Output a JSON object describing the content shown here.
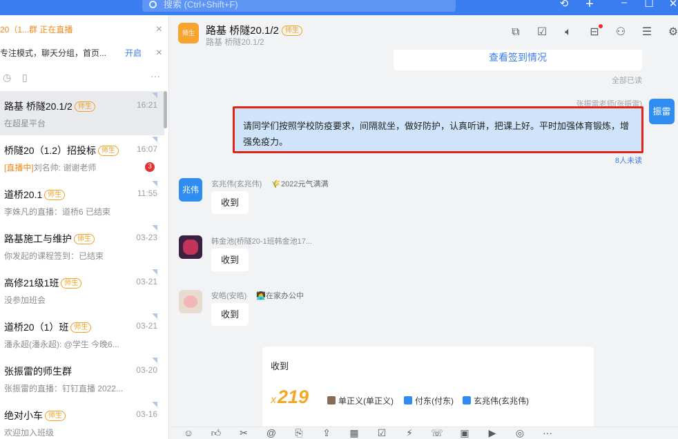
{
  "topbar": {
    "search_placeholder": "搜索 (Ctrl+Shift+F)",
    "icons": [
      "history-icon",
      "plus-icon",
      "minimize-icon",
      "maximize-icon",
      "close-icon"
    ]
  },
  "notices": [
    {
      "text": "20（1...群 正在直播"
    },
    {
      "text": "专注模式，聊天分组，首页...",
      "action": "开启"
    }
  ],
  "conversations": [
    {
      "name": "路基 桥隧20.1/2",
      "tag": "师生",
      "time": "16:21",
      "sub": "在超星平台",
      "live": "",
      "badge": ""
    },
    {
      "name": "桥隧20（1.2）招投标",
      "tag": "师生",
      "time": "16:07",
      "sub": "刘名帅: 谢谢老师",
      "live": "[直播中]",
      "badge": "3"
    },
    {
      "name": "道桥20.1",
      "tag": "师生",
      "time": "11:55",
      "sub": "李姝凡的直播：道桥6 已结束",
      "live": "",
      "badge": ""
    },
    {
      "name": "路基施工与维护",
      "tag": "师生",
      "time": "03-23",
      "sub": "你发起的课程签到：已结束",
      "live": "",
      "badge": ""
    },
    {
      "name": "高修21级1班",
      "tag": "师生",
      "time": "03-21",
      "sub": "没参加班会",
      "live": "",
      "badge": ""
    },
    {
      "name": "道桥20（1）班",
      "tag": "师生",
      "time": "03-21",
      "sub": "潘永超(潘永超): @学生 今晚6...",
      "live": "",
      "badge": ""
    },
    {
      "name": "张振雷的师生群",
      "tag": "",
      "time": "03-20",
      "sub": "张振雷的直播：钉钉直播 2022...",
      "live": "",
      "badge": ""
    },
    {
      "name": "绝对小车",
      "tag": "师生",
      "time": "03-16",
      "sub": "欢迎加入班级",
      "live": "",
      "badge": ""
    }
  ],
  "chat": {
    "logo_text": "师生",
    "title": "路基 桥隧20.1/2",
    "tag": "师生",
    "subtitle": "路基 桥隧20.1/2",
    "signin_link": "查看签到情况",
    "read_all": "全部已读",
    "my_sender": "张振雷老师(张振雷)",
    "my_avatar": "振雷",
    "my_message": "请同学们按照学校防疫要求，间隔就坐，做好防护，认真听讲，把课上好。平时加强体育锻炼，增强免疫力。",
    "unread": "8人未读",
    "messages": [
      {
        "avatar": "兆伟",
        "name": "玄兆伟(玄兆伟)",
        "status": "🌾2022元气满满",
        "text": "收到"
      },
      {
        "avatar": "",
        "name": "韩金池(桥隧20-1班韩金池17...",
        "status": "",
        "text": "收到"
      },
      {
        "avatar": "",
        "name": "安皓(安皓)",
        "status": "👩‍💻在家办公中",
        "text": "收到"
      }
    ],
    "card": {
      "title": "收到",
      "prefix": "x",
      "count": "219",
      "users": [
        "单正义(单正义)",
        "付东(付东)",
        "玄兆伟(玄兆伟)"
      ]
    }
  },
  "colors": {
    "accent": "#3a7df0",
    "highlight_border": "#e2231a",
    "tag_orange": "#f0a020",
    "badge_red": "#e8302f"
  }
}
